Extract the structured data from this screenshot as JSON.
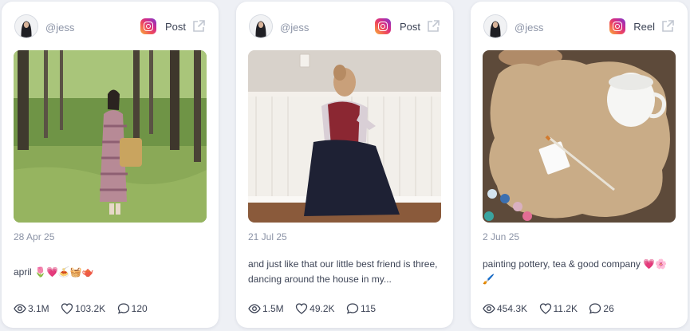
{
  "cards": [
    {
      "handle": "@jess",
      "platform_icon": "instagram-icon",
      "post_type": "Post",
      "date": "28 Apr 25",
      "caption": "april 🌷💗🍝🧺🫖",
      "views": "3.1M",
      "likes": "103.2K",
      "comments": "120"
    },
    {
      "handle": "@jess",
      "platform_icon": "instagram-icon",
      "post_type": "Post",
      "date": "21 Jul 25",
      "caption": "and just like that our little best friend is three, dancing around the house in my...",
      "views": "1.5M",
      "likes": "49.2K",
      "comments": "115"
    },
    {
      "handle": "@jess",
      "platform_icon": "instagram-icon",
      "post_type": "Reel",
      "date": "2 Jun 25",
      "caption": "painting pottery, tea & good company 💗🌸🖌️",
      "views": "454.3K",
      "likes": "11.2K",
      "comments": "26"
    }
  ],
  "colors": {
    "page_background": "#eef0f5",
    "card_background": "#ffffff",
    "muted_text": "#8b93a6",
    "body_text": "#3d4456"
  }
}
